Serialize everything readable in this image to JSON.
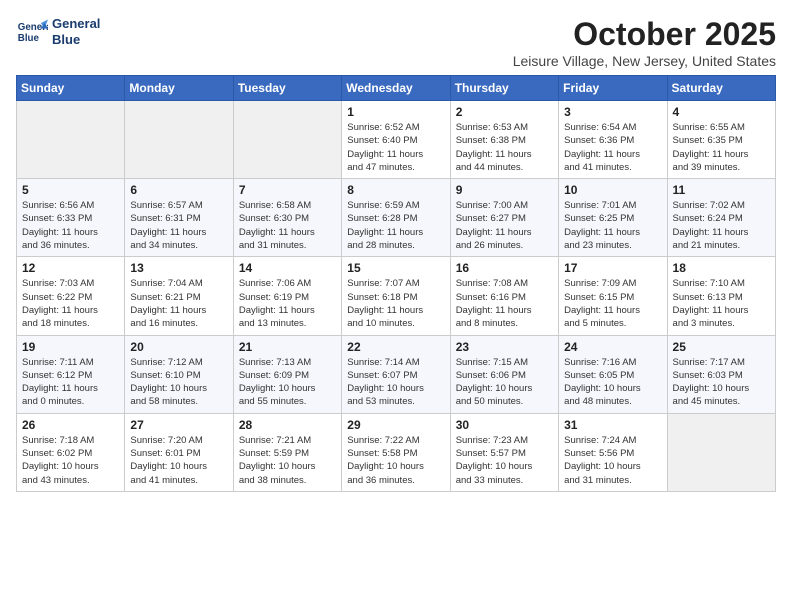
{
  "header": {
    "logo_line1": "General",
    "logo_line2": "Blue",
    "month": "October 2025",
    "location": "Leisure Village, New Jersey, United States"
  },
  "days_of_week": [
    "Sunday",
    "Monday",
    "Tuesday",
    "Wednesday",
    "Thursday",
    "Friday",
    "Saturday"
  ],
  "weeks": [
    [
      {
        "day": "",
        "info": ""
      },
      {
        "day": "",
        "info": ""
      },
      {
        "day": "",
        "info": ""
      },
      {
        "day": "1",
        "info": "Sunrise: 6:52 AM\nSunset: 6:40 PM\nDaylight: 11 hours\nand 47 minutes."
      },
      {
        "day": "2",
        "info": "Sunrise: 6:53 AM\nSunset: 6:38 PM\nDaylight: 11 hours\nand 44 minutes."
      },
      {
        "day": "3",
        "info": "Sunrise: 6:54 AM\nSunset: 6:36 PM\nDaylight: 11 hours\nand 41 minutes."
      },
      {
        "day": "4",
        "info": "Sunrise: 6:55 AM\nSunset: 6:35 PM\nDaylight: 11 hours\nand 39 minutes."
      }
    ],
    [
      {
        "day": "5",
        "info": "Sunrise: 6:56 AM\nSunset: 6:33 PM\nDaylight: 11 hours\nand 36 minutes."
      },
      {
        "day": "6",
        "info": "Sunrise: 6:57 AM\nSunset: 6:31 PM\nDaylight: 11 hours\nand 34 minutes."
      },
      {
        "day": "7",
        "info": "Sunrise: 6:58 AM\nSunset: 6:30 PM\nDaylight: 11 hours\nand 31 minutes."
      },
      {
        "day": "8",
        "info": "Sunrise: 6:59 AM\nSunset: 6:28 PM\nDaylight: 11 hours\nand 28 minutes."
      },
      {
        "day": "9",
        "info": "Sunrise: 7:00 AM\nSunset: 6:27 PM\nDaylight: 11 hours\nand 26 minutes."
      },
      {
        "day": "10",
        "info": "Sunrise: 7:01 AM\nSunset: 6:25 PM\nDaylight: 11 hours\nand 23 minutes."
      },
      {
        "day": "11",
        "info": "Sunrise: 7:02 AM\nSunset: 6:24 PM\nDaylight: 11 hours\nand 21 minutes."
      }
    ],
    [
      {
        "day": "12",
        "info": "Sunrise: 7:03 AM\nSunset: 6:22 PM\nDaylight: 11 hours\nand 18 minutes."
      },
      {
        "day": "13",
        "info": "Sunrise: 7:04 AM\nSunset: 6:21 PM\nDaylight: 11 hours\nand 16 minutes."
      },
      {
        "day": "14",
        "info": "Sunrise: 7:06 AM\nSunset: 6:19 PM\nDaylight: 11 hours\nand 13 minutes."
      },
      {
        "day": "15",
        "info": "Sunrise: 7:07 AM\nSunset: 6:18 PM\nDaylight: 11 hours\nand 10 minutes."
      },
      {
        "day": "16",
        "info": "Sunrise: 7:08 AM\nSunset: 6:16 PM\nDaylight: 11 hours\nand 8 minutes."
      },
      {
        "day": "17",
        "info": "Sunrise: 7:09 AM\nSunset: 6:15 PM\nDaylight: 11 hours\nand 5 minutes."
      },
      {
        "day": "18",
        "info": "Sunrise: 7:10 AM\nSunset: 6:13 PM\nDaylight: 11 hours\nand 3 minutes."
      }
    ],
    [
      {
        "day": "19",
        "info": "Sunrise: 7:11 AM\nSunset: 6:12 PM\nDaylight: 11 hours\nand 0 minutes."
      },
      {
        "day": "20",
        "info": "Sunrise: 7:12 AM\nSunset: 6:10 PM\nDaylight: 10 hours\nand 58 minutes."
      },
      {
        "day": "21",
        "info": "Sunrise: 7:13 AM\nSunset: 6:09 PM\nDaylight: 10 hours\nand 55 minutes."
      },
      {
        "day": "22",
        "info": "Sunrise: 7:14 AM\nSunset: 6:07 PM\nDaylight: 10 hours\nand 53 minutes."
      },
      {
        "day": "23",
        "info": "Sunrise: 7:15 AM\nSunset: 6:06 PM\nDaylight: 10 hours\nand 50 minutes."
      },
      {
        "day": "24",
        "info": "Sunrise: 7:16 AM\nSunset: 6:05 PM\nDaylight: 10 hours\nand 48 minutes."
      },
      {
        "day": "25",
        "info": "Sunrise: 7:17 AM\nSunset: 6:03 PM\nDaylight: 10 hours\nand 45 minutes."
      }
    ],
    [
      {
        "day": "26",
        "info": "Sunrise: 7:18 AM\nSunset: 6:02 PM\nDaylight: 10 hours\nand 43 minutes."
      },
      {
        "day": "27",
        "info": "Sunrise: 7:20 AM\nSunset: 6:01 PM\nDaylight: 10 hours\nand 41 minutes."
      },
      {
        "day": "28",
        "info": "Sunrise: 7:21 AM\nSunset: 5:59 PM\nDaylight: 10 hours\nand 38 minutes."
      },
      {
        "day": "29",
        "info": "Sunrise: 7:22 AM\nSunset: 5:58 PM\nDaylight: 10 hours\nand 36 minutes."
      },
      {
        "day": "30",
        "info": "Sunrise: 7:23 AM\nSunset: 5:57 PM\nDaylight: 10 hours\nand 33 minutes."
      },
      {
        "day": "31",
        "info": "Sunrise: 7:24 AM\nSunset: 5:56 PM\nDaylight: 10 hours\nand 31 minutes."
      },
      {
        "day": "",
        "info": ""
      }
    ]
  ]
}
